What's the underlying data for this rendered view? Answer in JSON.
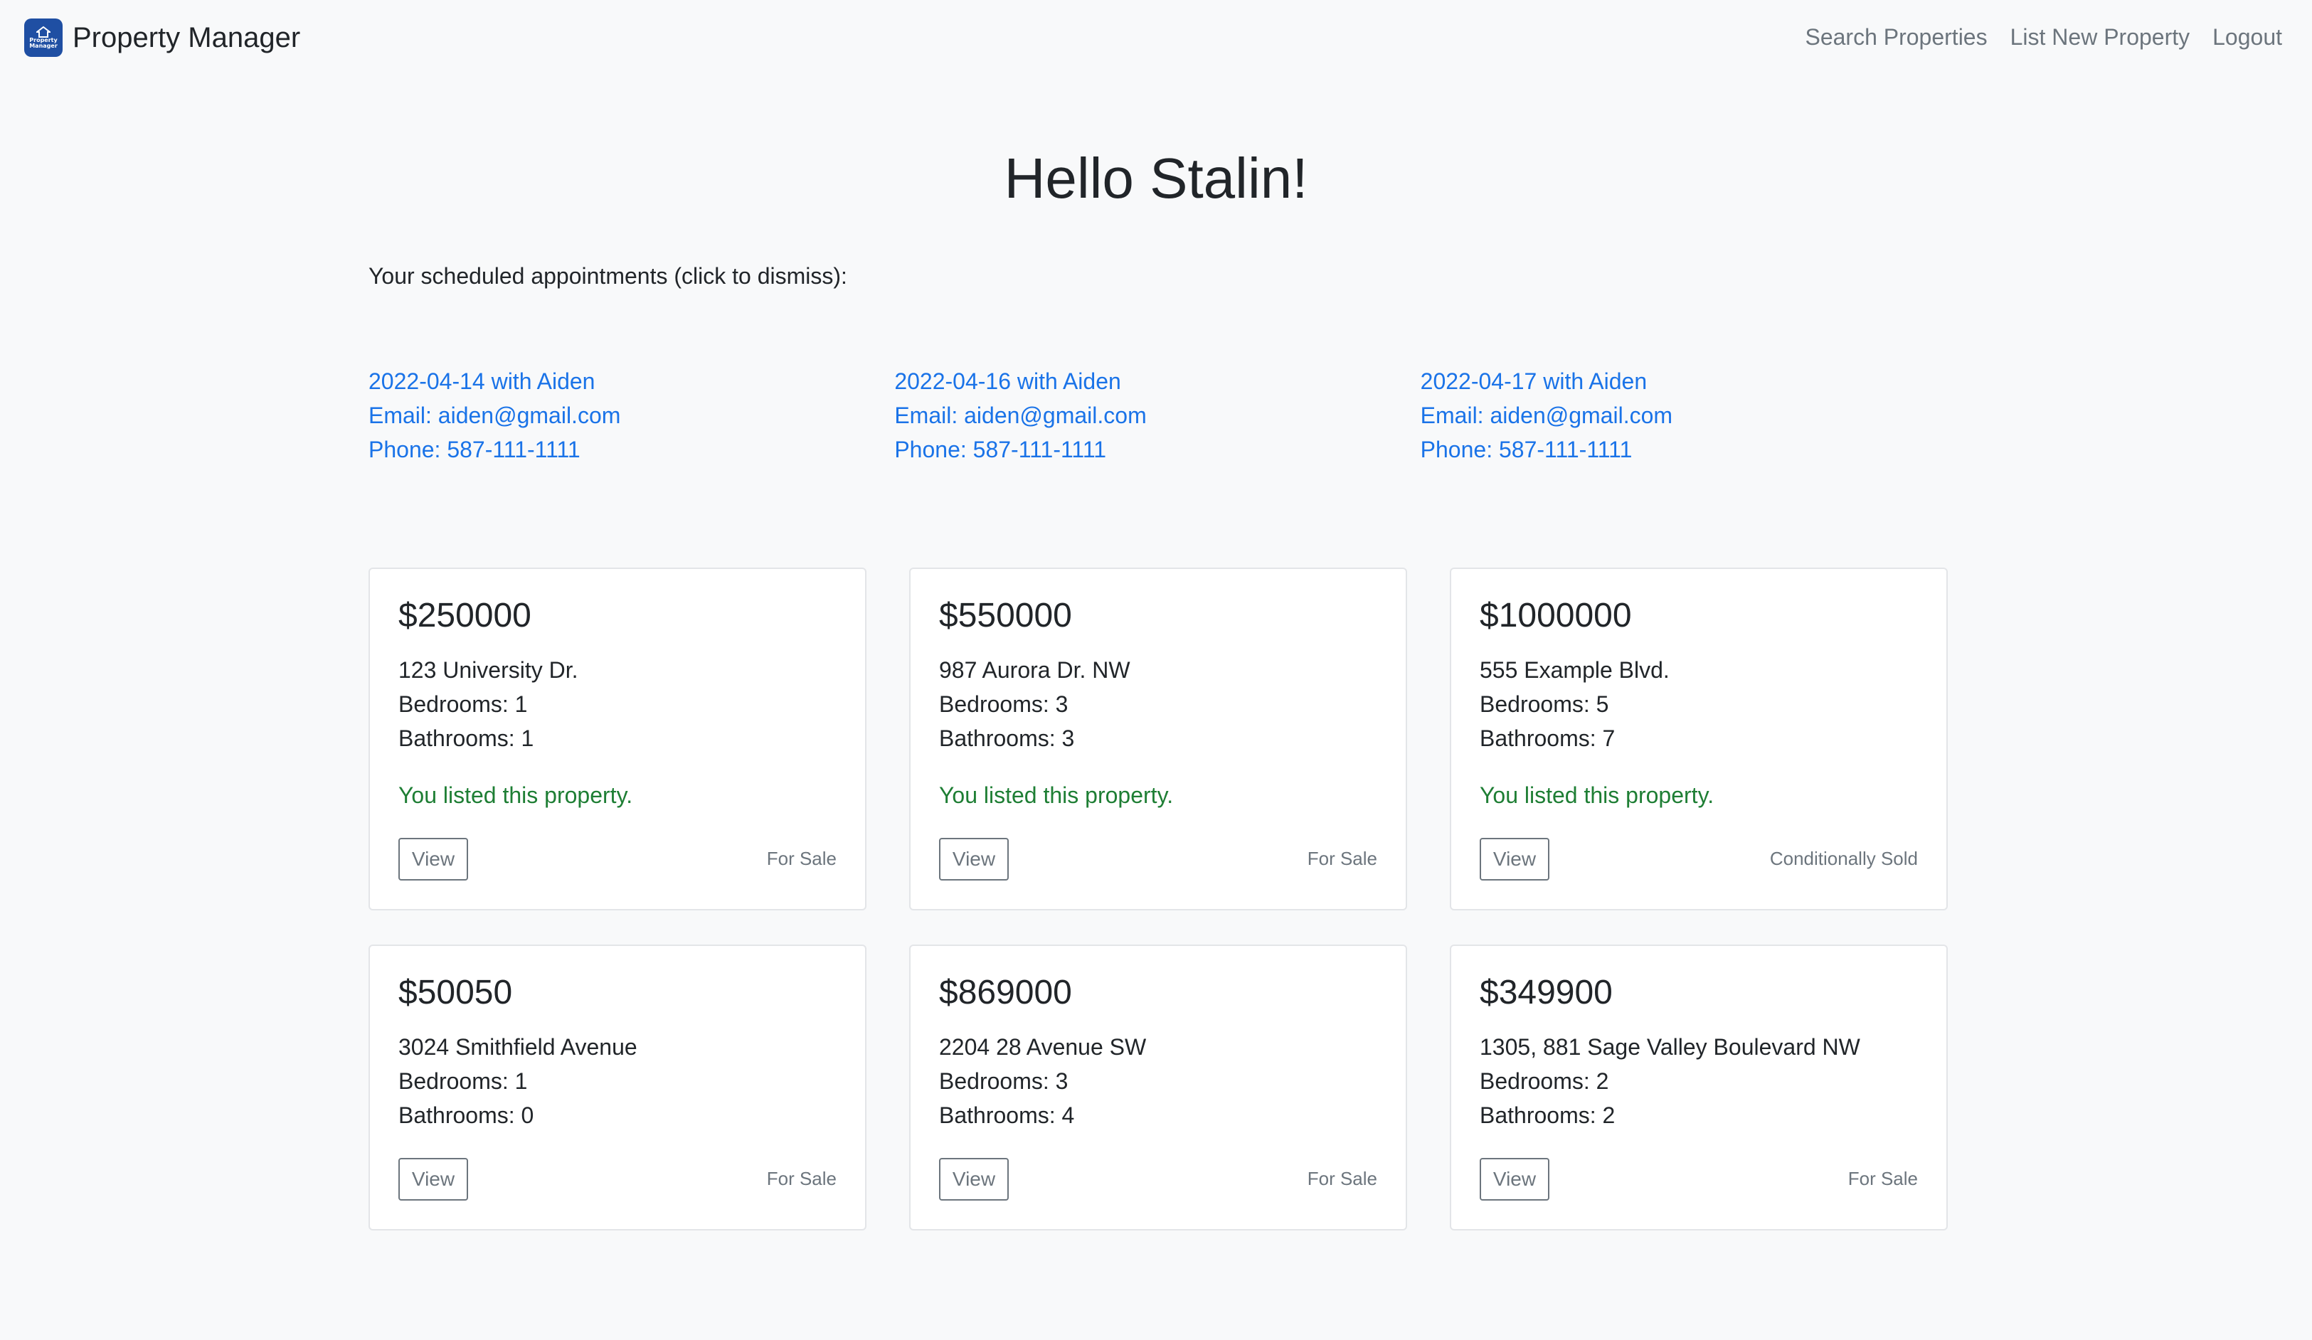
{
  "navbar": {
    "brand": "Property Manager",
    "logo_text_1": "Property",
    "logo_text_2": "Manager",
    "links": {
      "search": "Search Properties",
      "list_new": "List New Property",
      "logout": "Logout"
    }
  },
  "greeting": "Hello Stalin!",
  "appointments_intro": "Your scheduled appointments (click to dismiss):",
  "appointments": [
    {
      "title": "2022-04-14 with Aiden",
      "email": "Email: aiden@gmail.com",
      "phone": "Phone: 587-111-1111"
    },
    {
      "title": "2022-04-16 with Aiden",
      "email": "Email: aiden@gmail.com",
      "phone": "Phone: 587-111-1111"
    },
    {
      "title": "2022-04-17 with Aiden",
      "email": "Email: aiden@gmail.com",
      "phone": "Phone: 587-111-1111"
    }
  ],
  "properties": [
    {
      "price": "$250000",
      "address": "123 University Dr.",
      "bedrooms": "Bedrooms: 1",
      "bathrooms": "Bathrooms: 1",
      "listed": "You listed this property.",
      "view": "View",
      "status": "For Sale"
    },
    {
      "price": "$550000",
      "address": "987 Aurora Dr. NW",
      "bedrooms": "Bedrooms: 3",
      "bathrooms": "Bathrooms: 3",
      "listed": "You listed this property.",
      "view": "View",
      "status": "For Sale"
    },
    {
      "price": "$1000000",
      "address": "555 Example Blvd.",
      "bedrooms": "Bedrooms: 5",
      "bathrooms": "Bathrooms: 7",
      "listed": "You listed this property.",
      "view": "View",
      "status": "Conditionally Sold"
    },
    {
      "price": "$50050",
      "address": "3024 Smithfield Avenue",
      "bedrooms": "Bedrooms: 1",
      "bathrooms": "Bathrooms: 0",
      "view": "View",
      "status": "For Sale"
    },
    {
      "price": "$869000",
      "address": "2204 28 Avenue SW",
      "bedrooms": "Bedrooms: 3",
      "bathrooms": "Bathrooms: 4",
      "view": "View",
      "status": "For Sale"
    },
    {
      "price": "$349900",
      "address": "1305, 881 Sage Valley Boulevard NW",
      "bedrooms": "Bedrooms: 2",
      "bathrooms": "Bathrooms: 2",
      "view": "View",
      "status": "For Sale"
    }
  ],
  "colors": {
    "background": "#f8f9fa",
    "link_blue": "#1a73e8",
    "listed_green": "#1e7e34",
    "muted_gray": "#6c757d",
    "logo_blue": "#1f4fa3"
  }
}
